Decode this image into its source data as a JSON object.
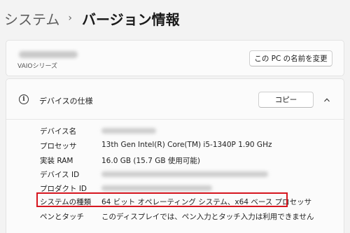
{
  "breadcrumb": {
    "parent": "システム",
    "separator": "›",
    "current": "バージョン情報"
  },
  "device": {
    "name": "",
    "model": "VAIOシリーズ",
    "rename_button": "この PC の名前を変更"
  },
  "spec": {
    "title": "デバイスの仕様",
    "copy_button": "コピー",
    "rows": [
      {
        "label": "デバイス名",
        "value": ""
      },
      {
        "label": "プロセッサ",
        "value": "13th Gen Intel(R) Core(TM) i5-1340P   1.90 GHz"
      },
      {
        "label": "実装 RAM",
        "value": "16.0 GB (15.7 GB 使用可能)"
      },
      {
        "label": "デバイス ID",
        "value": ""
      },
      {
        "label": "プロダクト ID",
        "value": ""
      },
      {
        "label": "システムの種類",
        "value": "64 ビット オペレーティング システム、x64 ベース プロセッサ"
      },
      {
        "label": "ペンとタッチ",
        "value": "このディスプレイでは、ペン入力とタッチ入力は利用できません"
      }
    ]
  },
  "icons": {
    "info": "info-icon",
    "collapse": "chevron-up-icon",
    "breadcrumb_separator": "chevron-right-icon"
  },
  "colors": {
    "highlight": "#d6161f",
    "background": "#f3f3f3",
    "card": "#fbfbfb"
  }
}
